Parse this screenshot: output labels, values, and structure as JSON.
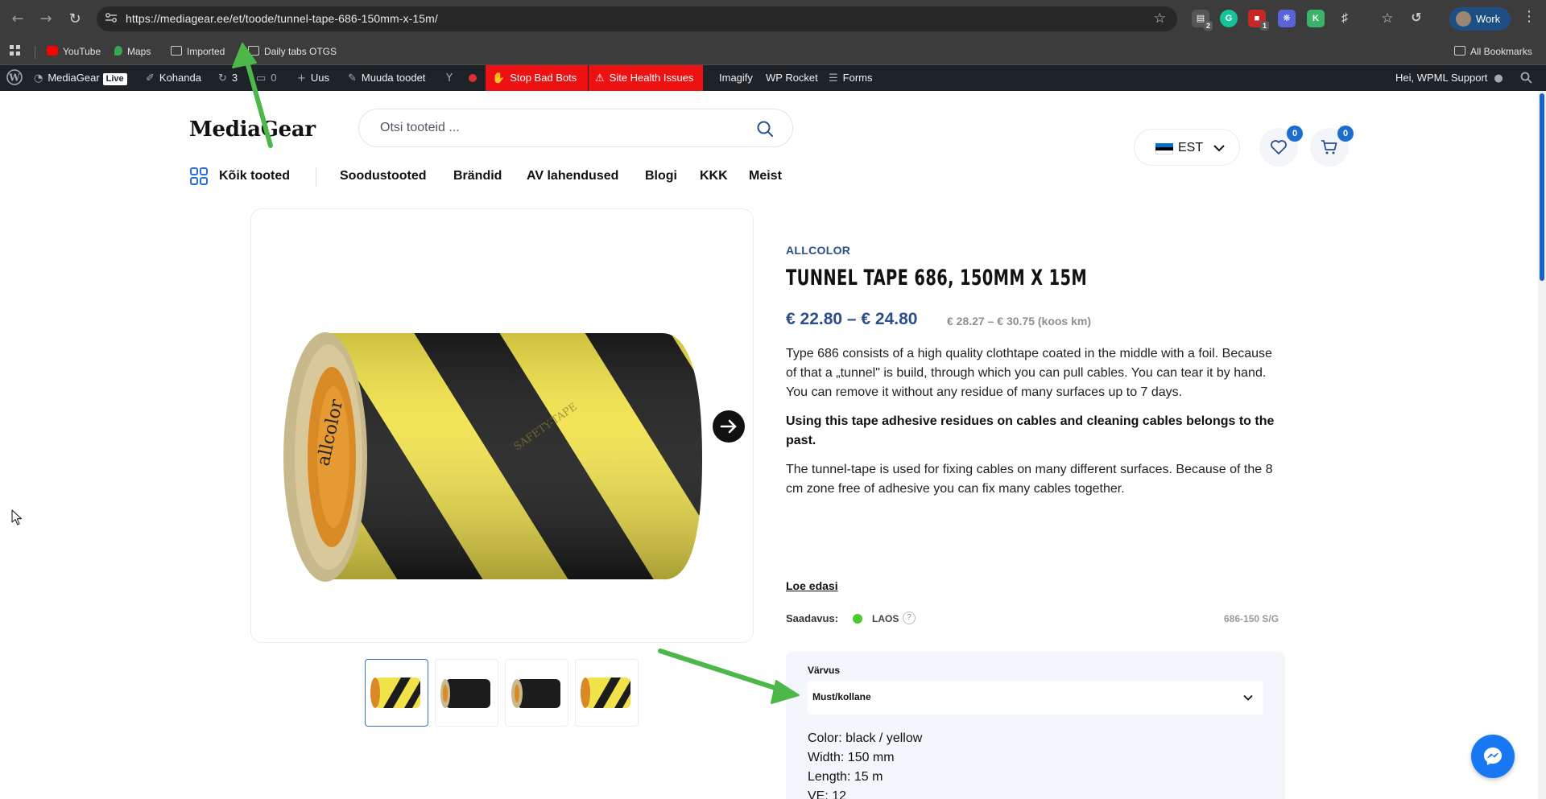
{
  "browser": {
    "url": "https://mediagear.ee/et/toode/tunnel-tape-686-150mm-x-15m/",
    "profile_label": "Work",
    "extension_badges": [
      "2",
      "1"
    ],
    "bookmarks": [
      {
        "label": "YouTube",
        "icon": "youtube-icon"
      },
      {
        "label": "Maps",
        "icon": "maps-icon"
      },
      {
        "label": "Imported",
        "icon": "folder-icon"
      },
      {
        "label": "Daily tabs OTGS",
        "icon": "folder-icon"
      }
    ],
    "all_bookmarks_label": "All Bookmarks"
  },
  "adminbar": {
    "site_name": "MediaGear",
    "live_badge": "Live",
    "customize": "Kohanda",
    "updates_count": "3",
    "comments_count": "0",
    "new": "Uus",
    "edit": "Muuda toodet",
    "stop_bad_bots": "Stop Bad Bots",
    "site_health": "Site Health Issues",
    "imagify": "Imagify",
    "wp_rocket": "WP Rocket",
    "forms": "Forms",
    "greeting": "Hei, WPML Support"
  },
  "site": {
    "logo": "MediaGear",
    "search_placeholder": "Otsi tooteid ...",
    "language_code": "EST",
    "wishlist_count": "0",
    "cart_count": "0",
    "nav": {
      "all_products": "Kõik tooted",
      "items": [
        "Soodustooted",
        "Brändid",
        "AV lahendused",
        "Blogi",
        "KKK",
        "Meist"
      ]
    }
  },
  "product": {
    "brand": "ALLCOLOR",
    "title": "TUNNEL TAPE 686, 150MM X 15M",
    "price_range": "€ 22.80  –  € 24.80",
    "price_with_vat": "€ 28.27 – € 30.75 (koos km)",
    "description_1": "Type 686 consists of a high quality clothtape coated in the middle with a foil. Because of that a „tunnel\" is build, through which you can pull cables. You can tear it by hand. You can remove it without any residue of many surfaces up to 7 days.",
    "description_2": "Using this tape adhesive residues on cables and cleaning cables belongs to the past.",
    "description_3": "The tunnel-tape is used for fixing cables on many different surfaces. Because of the 8 cm zone free of adhesive you can fix many cables together.",
    "read_more": "Loe edasi",
    "availability_label": "Saadavus:",
    "availability_value": "LAOS",
    "availability_help": "?",
    "sku": "686-150 S/G",
    "variant_label": "Värvus",
    "variant_value": "Must/kollane",
    "specs": [
      "Color: black / yellow",
      "Width: 150 mm",
      "Length: 15 m",
      "VE: 12"
    ],
    "image_text": "allcolor",
    "image_tape_text": "SAFETY-TAPE"
  },
  "colors": {
    "accent": "#2b4e8f",
    "badge": "#1c6dd0",
    "available": "#4cc92c",
    "annotation": "#4cb84a"
  }
}
